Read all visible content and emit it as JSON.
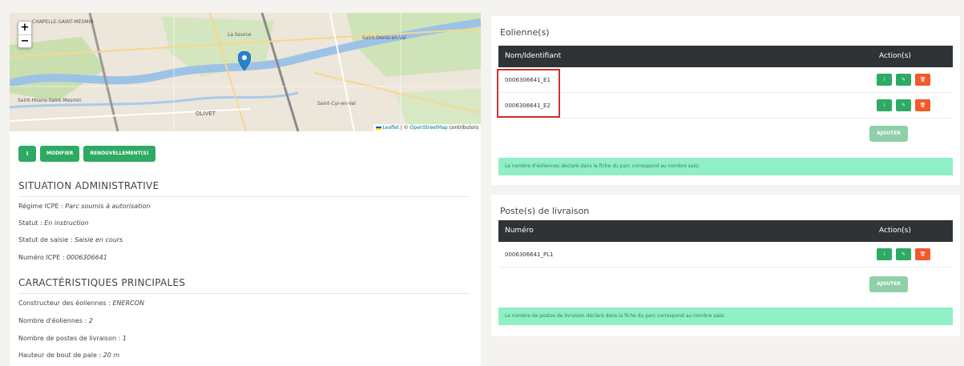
{
  "map": {
    "zoom_in": "+",
    "zoom_out": "−",
    "labels": [
      "CHAPELLE-SAINT-MESMIN",
      "OLIVET",
      "La Source",
      "Saint-Hilaire-Saint-Mesmin",
      "Saint-Denis-en-Val",
      "Saint-Cyr-en-Val"
    ],
    "attribution_leaflet": "Leaflet",
    "attribution_sep": " | © ",
    "attribution_osm": "OpenStreetMap",
    "attribution_suffix": " contributors"
  },
  "toolbar": {
    "info_label": "i",
    "modify_label": "MODIFIER",
    "renewal_label": "RENOUVELLEMENT(S)"
  },
  "admin": {
    "title": "SITUATION ADMINISTRATIVE",
    "items": [
      {
        "label": "Régime ICPE : ",
        "value": "Parc soumis à autorisation"
      },
      {
        "label": "Statut : ",
        "value": "En instruction"
      },
      {
        "label": "Statut de saisie : ",
        "value": "Saisie en cours"
      },
      {
        "label": "Numéro ICPE : ",
        "value": "0006306641"
      }
    ]
  },
  "characteristics": {
    "title": "CARACTÉRISTIQUES PRINCIPALES",
    "items": [
      {
        "label": "Constructeur des éoliennes : ",
        "value": "ENERCON"
      },
      {
        "label": "Nombre d'éoliennes : ",
        "value": "2"
      },
      {
        "label": "Nombre de postes de livraison : ",
        "value": "1"
      },
      {
        "label": "Hauteur de bout de pale : ",
        "value": "20 m"
      }
    ]
  },
  "eoliennes": {
    "title": "Eolienne(s)",
    "col_name": "Nom/Identifiant",
    "col_actions": "Action(s)",
    "rows": [
      "0006306641_E1",
      "0006306641_E2"
    ],
    "add_label": "AJOUTER",
    "alert": "Le nombre d'éoliennes déclaré dans la fiche du parc correspond au nombre saisi."
  },
  "postes": {
    "title": "Poste(s) de livraison",
    "col_name": "Numéro",
    "col_actions": "Action(s)",
    "rows": [
      "0006306641_PL1"
    ],
    "add_label": "AJOUTER",
    "alert": "Le nombre de postes de livraison déclaré dans la fiche du parc correspond au nombre saisi."
  },
  "icons": {
    "info": "i",
    "edit": "✎",
    "delete": "🗑"
  },
  "colors": {
    "green": "#2daa63",
    "orange": "#f15a2b",
    "dark_header": "#2f3336",
    "alert_bg": "#8ef0c4",
    "highlight": "#d32f2f",
    "marker": "#2a81cb"
  }
}
